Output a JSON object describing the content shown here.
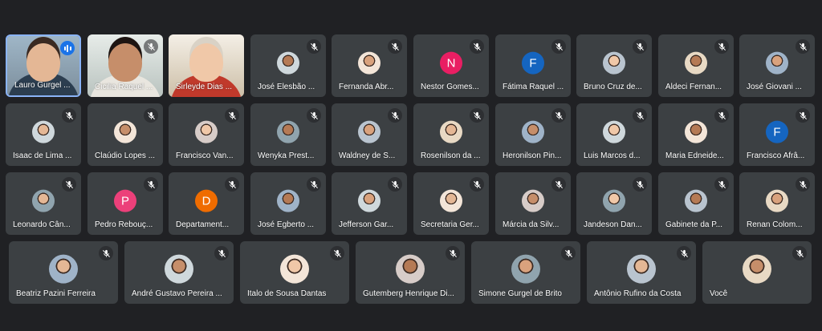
{
  "colors": {
    "background": "#202124",
    "tile": "#3c4043",
    "speaking_border": "#8ab4f8",
    "speaking_badge": "#1a73e8"
  },
  "participants": [
    {
      "name": "Lauro Gurgel ...",
      "kind": "video",
      "speaking": true
    },
    {
      "name": "Cicilia Raquel ...",
      "kind": "video",
      "muted": true
    },
    {
      "name": "Sirleyde Dias ...",
      "kind": "video"
    },
    {
      "name": "José Elesbão ...",
      "kind": "photo",
      "muted": true
    },
    {
      "name": "Fernanda Abr...",
      "kind": "photo",
      "muted": true
    },
    {
      "name": "Nestor Gomes...",
      "kind": "letter",
      "letter": "N",
      "color": "#e91e63",
      "muted": true
    },
    {
      "name": "Fátima Raquel ...",
      "kind": "letter",
      "letter": "F",
      "color": "#1565c0",
      "muted": true
    },
    {
      "name": "Bruno Cruz de...",
      "kind": "photo",
      "muted": true
    },
    {
      "name": "Aldeci Fernan...",
      "kind": "photo",
      "muted": true
    },
    {
      "name": "José Giovani ...",
      "kind": "photo",
      "muted": true
    },
    {
      "name": "Isaac de Lima ...",
      "kind": "photo",
      "muted": true
    },
    {
      "name": "Claúdio Lopes ...",
      "kind": "photo",
      "muted": true
    },
    {
      "name": "Francisco Van...",
      "kind": "photo",
      "muted": true
    },
    {
      "name": "Wenyka Prest...",
      "kind": "photo",
      "muted": true
    },
    {
      "name": "Waldney de S...",
      "kind": "photo",
      "muted": true
    },
    {
      "name": "Rosenilson da ...",
      "kind": "photo",
      "muted": true
    },
    {
      "name": "Heronilson Pin...",
      "kind": "photo",
      "muted": true
    },
    {
      "name": "Luis Marcos d...",
      "kind": "photo",
      "muted": true
    },
    {
      "name": "Maria Edneide...",
      "kind": "photo",
      "muted": true
    },
    {
      "name": "Francisco Afrâ...",
      "kind": "letter",
      "letter": "F",
      "color": "#1565c0",
      "muted": true
    },
    {
      "name": "Leonardo Cân...",
      "kind": "photo",
      "muted": true
    },
    {
      "name": "Pedro Rebouç...",
      "kind": "letter",
      "letter": "P",
      "color": "#ec407a",
      "muted": true
    },
    {
      "name": "Departament...",
      "kind": "letter",
      "letter": "D",
      "color": "#ef6c00",
      "muted": true
    },
    {
      "name": "José Egberto ...",
      "kind": "photo",
      "muted": true
    },
    {
      "name": "Jefferson Gar...",
      "kind": "photo",
      "muted": true
    },
    {
      "name": "Secretaria Ger...",
      "kind": "photo",
      "muted": true
    },
    {
      "name": "Márcia da Silv...",
      "kind": "photo",
      "muted": true
    },
    {
      "name": "Jandeson Dan...",
      "kind": "photo",
      "muted": true
    },
    {
      "name": "Gabinete da P...",
      "kind": "photo",
      "muted": true
    },
    {
      "name": "Renan Colom...",
      "kind": "photo",
      "muted": true
    },
    {
      "name": "Beatriz Pazini Ferreira",
      "kind": "photo",
      "muted": true
    },
    {
      "name": "André Gustavo Pereira ...",
      "kind": "photo",
      "muted": true
    },
    {
      "name": "Italo de Sousa Dantas",
      "kind": "photo",
      "muted": true
    },
    {
      "name": "Gutemberg Henrique Di...",
      "kind": "photo",
      "muted": true
    },
    {
      "name": "Simone Gurgel de Brito",
      "kind": "photo",
      "muted": true
    },
    {
      "name": "Antônio Rufino da Costa",
      "kind": "photo",
      "muted": true
    },
    {
      "name": "Você",
      "kind": "photo",
      "muted": true
    }
  ]
}
